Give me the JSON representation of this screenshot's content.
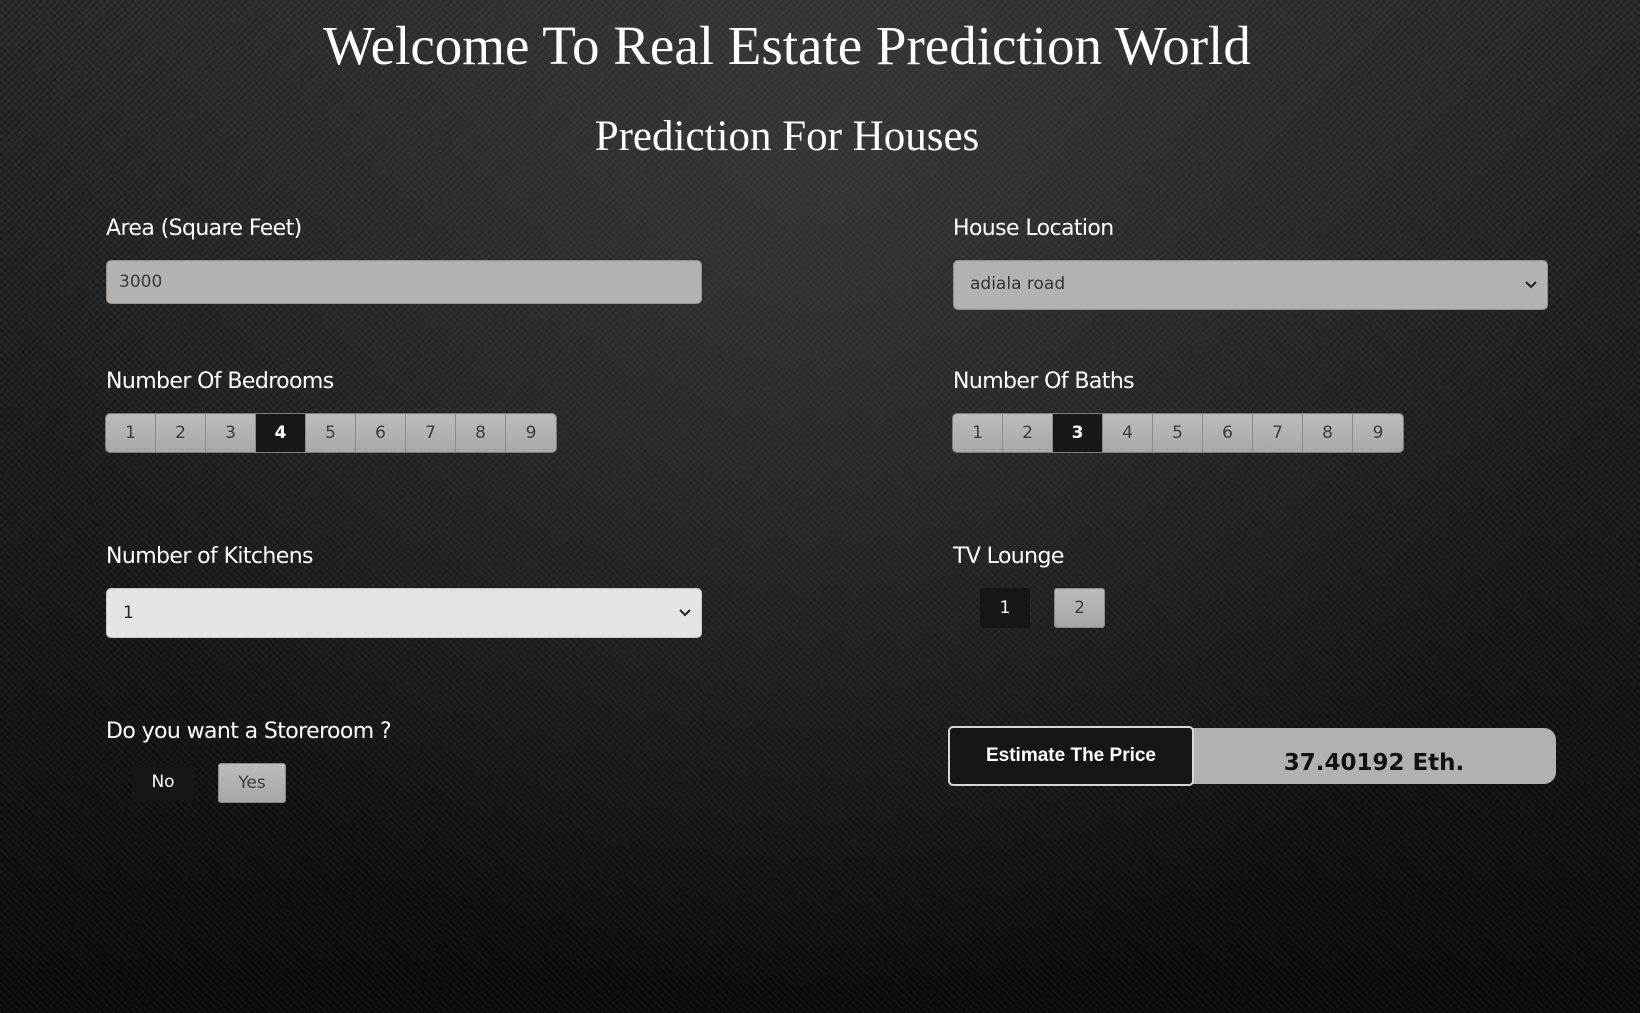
{
  "header": {
    "title": "Welcome To Real Estate Prediction World",
    "subtitle": "Prediction For Houses"
  },
  "area": {
    "label": "Area (Square Feet)",
    "value": "3000"
  },
  "location": {
    "label": "House Location",
    "selected": "adiala road"
  },
  "bedrooms": {
    "label": "Number Of Bedrooms",
    "options": [
      "1",
      "2",
      "3",
      "4",
      "5",
      "6",
      "7",
      "8",
      "9"
    ],
    "selected": "4"
  },
  "baths": {
    "label": "Number Of Baths",
    "options": [
      "1",
      "2",
      "3",
      "4",
      "5",
      "6",
      "7",
      "8",
      "9"
    ],
    "selected": "3"
  },
  "kitchens": {
    "label": "Number of Kitchens",
    "selected": "1"
  },
  "tv_lounge": {
    "label": "TV Lounge",
    "options": [
      "1",
      "2"
    ],
    "selected": "1"
  },
  "storeroom": {
    "label": "Do you want a Storeroom ?",
    "options": [
      "No",
      "Yes"
    ],
    "selected": "No"
  },
  "estimate": {
    "button_label": "Estimate The Price",
    "result": "37.40192 Eth."
  },
  "icons": {
    "select_chevron": "chevron-down-icon"
  },
  "colors": {
    "active_button": "#161616",
    "inactive_button": "#b3b2b0",
    "text": "#ffffff"
  }
}
